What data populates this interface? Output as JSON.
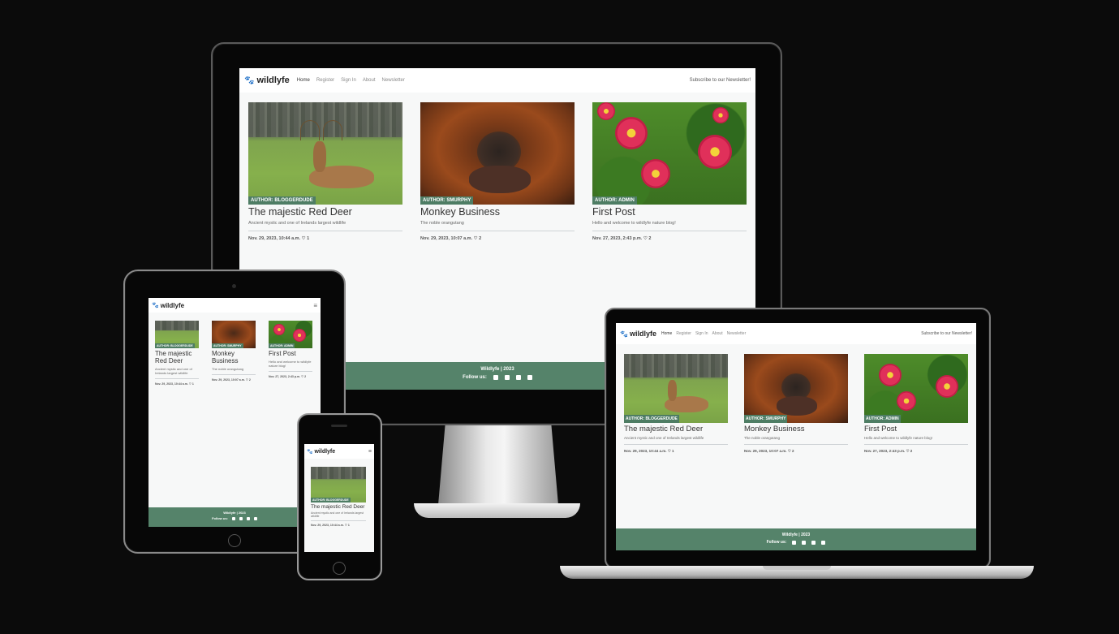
{
  "site": {
    "brand": "wildlyfe",
    "nav": [
      "Home",
      "Register",
      "Sign In",
      "About",
      "Newsletter"
    ],
    "subscribe": "Subscribe to our Newsletter!",
    "footer_brand": "Wildlyfe | 2023",
    "footer_follow": "Follow us:",
    "social_icons": [
      "facebook-icon",
      "twitter-icon",
      "instagram-icon",
      "youtube-icon"
    ]
  },
  "posts": [
    {
      "author": "AUTHOR: BLOGGERDUDE",
      "title": "The majestic Red Deer",
      "excerpt": "Ancient mystic and one of Irelands largest wildlife",
      "date": "Nov. 29, 2023, 10:44 a.m.",
      "likes": "1"
    },
    {
      "author": "AUTHOR: SMURPHY",
      "title": "Monkey Business",
      "excerpt": "The noble orangutang",
      "date": "Nov. 29, 2023, 10:07 a.m.",
      "likes": "2"
    },
    {
      "author": "AUTHOR: ADMIN",
      "title": "First Post",
      "excerpt": "Hello and welcome to wildlyfe nature blog!",
      "date": "Nov. 27, 2023, 2:43 p.m.",
      "likes": "2"
    }
  ],
  "tablet": {
    "titles": [
      "The majestic Red Deer",
      "Monkey Business",
      "First Post"
    ],
    "excerpts": [
      "Ancient mystic and one of Irelands largest wildlife",
      "The noble orangutang",
      "Hello and welcome to wildlyfe nature blog!"
    ],
    "dates": [
      "Nov. 29, 2023, 10:44 a.m.",
      "Nov. 29, 2023, 10:07 a.m.",
      "Nov. 27, 2023, 2:43 p.m."
    ],
    "likes": [
      "1",
      "2",
      "2"
    ]
  },
  "colors": {
    "accent": "#55836a",
    "badge": "#4e7d64",
    "page_bg": "#0b0b0b"
  }
}
